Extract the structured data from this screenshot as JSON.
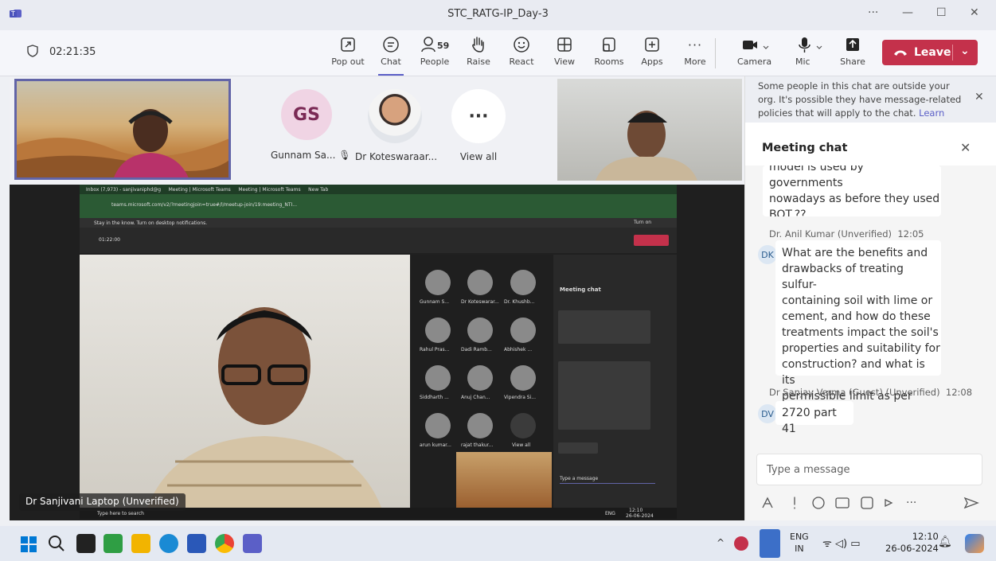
{
  "window": {
    "title": "STC_RATG-IP_Day-3",
    "more": "···"
  },
  "toolbar": {
    "timer": "02:21:35",
    "buttons": [
      {
        "label": "Pop out",
        "icon": "pop-out-icon"
      },
      {
        "label": "Chat",
        "icon": "chat-icon"
      },
      {
        "label": "People",
        "icon": "people-icon",
        "count": "59"
      },
      {
        "label": "Raise",
        "icon": "hand-icon"
      },
      {
        "label": "React",
        "icon": "smiley-icon"
      },
      {
        "label": "View",
        "icon": "grid-icon"
      },
      {
        "label": "Rooms",
        "icon": "rooms-icon"
      },
      {
        "label": "Apps",
        "icon": "apps-icon"
      },
      {
        "label": "More",
        "icon": "more-icon"
      },
      {
        "label": "Camera",
        "icon": "camera-icon"
      },
      {
        "label": "Mic",
        "icon": "mic-icon"
      },
      {
        "label": "Share",
        "icon": "share-icon"
      }
    ],
    "leave": "Leave"
  },
  "stage": {
    "participants": [
      {
        "initials": "GS",
        "name": "Gunnam Sa...",
        "avatar_color": "#f0d4e4"
      },
      {
        "initials": "",
        "name": "Dr Koteswaraar..."
      },
      {
        "initials": "···",
        "name": "View all"
      }
    ],
    "presenter_label": "Dr Sanjivani Laptop (Unverified)"
  },
  "shared_screen": {
    "tabs": [
      "Inbox (7,973) - sanjivaniphd@g",
      "Meeting | Microsoft Teams",
      "Meeting | Microsoft Teams",
      "New Tab"
    ],
    "url": "teams.microsoft.com/v2/?meetingjoin=true#/l/meetup-join/19:meeting_NTI...",
    "banner": "Stay in the know. Turn on desktop notifications.",
    "turn_on": "Turn on",
    "timer": "01:22:00",
    "grid_names": [
      "Gunnam S...",
      "Dr Koteswarar...",
      "Dr. Khushb...",
      "Rahul Pras...",
      "Dadi Ramb...",
      "Abhishek ...",
      "Siddharth ...",
      "Anuj Chan...",
      "Vipendra Si...",
      "arun kumar...",
      "rajat thakur...",
      "View all"
    ],
    "meeting_chat": "Meeting chat",
    "type_message": "Type a message",
    "search": "Type here to search",
    "time": "12:10",
    "date": "26-06-2024",
    "lang": "ENG"
  },
  "chat": {
    "notice": "Some people in this chat are outside your org. It's possible they have message-related policies that will apply to the chat.",
    "learn_more": "Learn more",
    "title": "Meeting chat",
    "prev_text": [
      "model is used by governments",
      "nowadays as before they used",
      "BOT.??"
    ],
    "messages": [
      {
        "sender": "Dr. Anil Kumar (Unverified)",
        "time": "12:05",
        "initials": "DK",
        "lines": [
          "What are the benefits and",
          "drawbacks of treating sulfur-",
          "containing soil with lime or",
          "cement, and how do these",
          "treatments impact the soil's",
          "properties and suitability for",
          "construction? and what is its",
          "permissible limit as per codes ?"
        ]
      },
      {
        "sender": "Dr Sanjay Verma (Guest) (Unverified)",
        "time": "12:08",
        "initials": "DV",
        "lines": [
          "2720 part 41"
        ]
      }
    ],
    "compose_placeholder": "Type a message"
  },
  "taskbar": {
    "lang_1": "ENG",
    "lang_2": "IN",
    "time": "12:10",
    "date": "26-06-2024"
  }
}
